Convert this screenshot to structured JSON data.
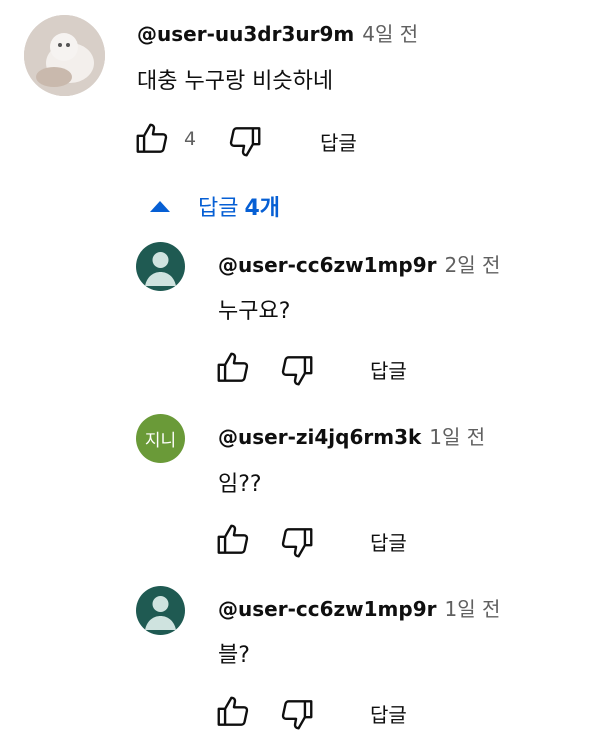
{
  "comment": {
    "handle": "@user-uu3dr3ur9m",
    "time": "4일 전",
    "text": "대충 누구랑 비슷하네",
    "likes": "4",
    "reply_label": "답글"
  },
  "replies_toggle": {
    "label": "답글",
    "count": "4개",
    "icon": "caret-up-icon"
  },
  "replies": [
    {
      "handle": "@user-cc6zw1mp9r",
      "time": "2일 전",
      "text": "누구요?",
      "reply_label": "답글",
      "avatar": "default-person"
    },
    {
      "handle": "@user-zi4jq6rm3k",
      "time": "1일 전",
      "text": "임??",
      "reply_label": "답글",
      "avatar_text": "지니"
    },
    {
      "handle": "@user-cc6zw1mp9r",
      "time": "1일 전",
      "text": "블?",
      "reply_label": "답글",
      "avatar": "default-person"
    }
  ],
  "colors": {
    "link": "#065fd4",
    "secondary": "#606060",
    "avatar_teal": "#1f5a52",
    "avatar_green": "#6a9a38"
  }
}
